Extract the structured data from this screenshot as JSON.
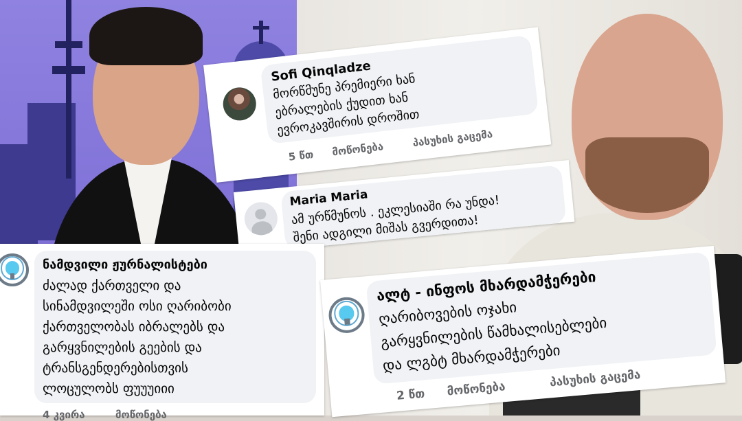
{
  "cards": [
    {
      "name": "Sofi Qinqladze",
      "lines": [
        "მორწმუნე პრემიერი ხან",
        "ებრალების ქუდით ხან",
        "ევროკავშირის დროშით"
      ],
      "time": "5 წთ",
      "like": "მოწონება",
      "reply": "პასუხის გაცემა"
    },
    {
      "name": "Maria Maria",
      "lines": [
        "ამ ურწმუნოს . ეკლესიაში რა უნდა!",
        "შენი ადგილი მიშას გვერდითა!"
      ]
    },
    {
      "name": "ნამდვილი ჟურნალისტები",
      "lines": [
        "ძალად ქართველი და",
        "სინამდვილეში ოსი ღარიბობი",
        "ქართველობას იბრალებს და",
        "გარყვნილების გეების და",
        "ტრანსგენდერებისთვის",
        "ლოცულობს ფუუუიიი"
      ],
      "time": "4 კვირა",
      "like": "მოწონება"
    },
    {
      "name": "ალტ - ინფოს მხარდამჭერები",
      "lines": [
        "ღარიბოვების ოჯახი",
        "გარყვნილების წამხალისებლები",
        "და ლგბტ მხარდამჭერები"
      ],
      "time": "2 წთ",
      "like": "მოწონება",
      "reply": "პასუხის გაცემა"
    }
  ],
  "colors": {
    "bubble": "#f0f2f5",
    "meta": "#65676b",
    "left_backdrop": "#7e70d6",
    "right_backdrop": "#ebe8e3"
  }
}
